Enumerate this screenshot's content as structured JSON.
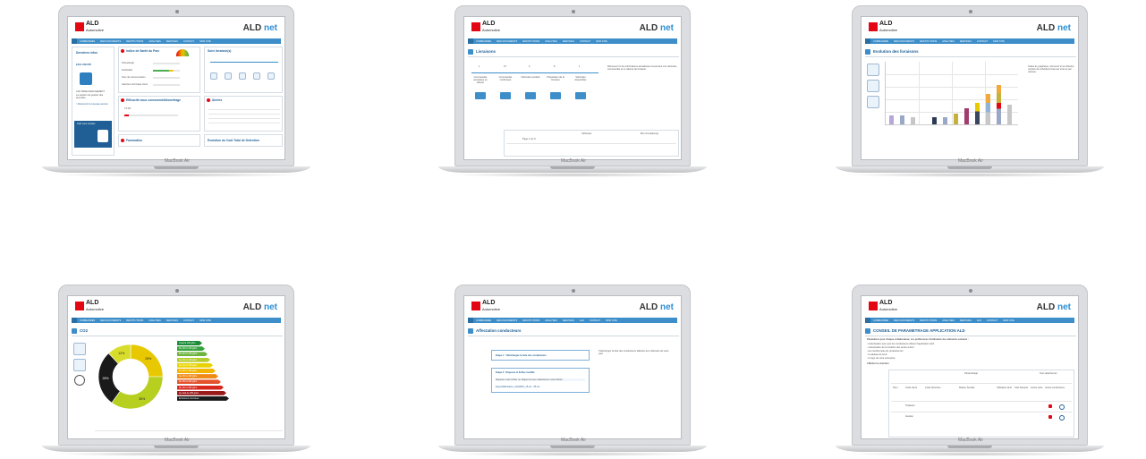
{
  "brand": {
    "logo_main": "ALD",
    "logo_sub": "Automotive",
    "product": "ALD",
    "product_suffix": "net"
  },
  "device_label": "MacBook Air",
  "nav_items_a": [
    "COMMANDES",
    "MES DOCUMENTS",
    "RESTITUTIONS",
    "ANALYSES",
    "SERVICES",
    "CONTACT",
    "MON SITE"
  ],
  "nav_items_b": [
    "COMMANDES",
    "MES DOCUMENTS",
    "RESTITUTIONS",
    "ANALYSES",
    "SERVICES",
    "ALD",
    "CONTACT",
    "MON SITE"
  ],
  "screens": {
    "s1": {
      "sidebar_title": "Dernières infos",
      "exclusive": "EXCLUSIVITÉ",
      "news_title": "ALD FREE MANAGEMENT",
      "news_text": "La solution de gestion des amendes",
      "news_link": "> Découvrir le nouveau service",
      "card_title": "ALD vous contact",
      "panel_health": "Indice de Santé du Parc",
      "health_rows": [
        "Kilométrage",
        "Sinistralité",
        "Taux de consommation",
        "Attention technique client"
      ],
      "panel_fuel": "Suivi livraison(s)",
      "panel_fuel_sub": "Efficacité sous consommé/kilométrage",
      "fuel_pct": "74.2%",
      "panel_alerts": "Alertes",
      "panel_invoices": "Facturation",
      "panel_tco": "Evolution du Coût Total de Détention"
    },
    "s2": {
      "title": "Livraisons",
      "steps_numbers": [
        "1",
        "37",
        "2",
        "8",
        "1"
      ],
      "steps": [
        "Commandes acceptées en attente",
        "Commandes confirmées",
        "Véhicules produits",
        "Préparation de la livraison",
        "Véhicules disponibles"
      ],
      "desc": "Retrouvez ici les informations actualisées concernant vos véhicules commandés et en attente de livraison.",
      "table_title": "Véhicules",
      "table_side": "Bon circulation(s)",
      "pager": "Page 1 sur 9"
    },
    "s3": {
      "title": "Evolution des livraisons",
      "desc": "Grâce au graphique, retrouvez ici en détail le nombre de véhicules livrés par mois et par marque."
    },
    "s4": {
      "title": "CO2",
      "legend": [
        "Jusqu'à 100 g/km",
        "De 101 à 120 g/km",
        "De 121 à 130 g/km",
        "De 131 à 140 g/km",
        "De 141 à 150 g/km",
        "De 151 à 160 g/km",
        "De 161 à 190 g/km",
        "De 191 à 200 g/km",
        "De 201 à 250 g/km",
        "Au delà de 250 g/km",
        "Emissions inconnues"
      ],
      "donut": [
        {
          "label": "25%",
          "value": 25,
          "color": "#e8c800"
        },
        {
          "label": "35%",
          "value": 35,
          "color": "#b7cf1f"
        },
        {
          "label": "28%",
          "value": 28,
          "color": "#1a1a1a"
        },
        {
          "label": "12%",
          "value": 12,
          "color": "#d8dc2a"
        }
      ]
    },
    "s5": {
      "title": "Affectation conducteurs",
      "step1": "Etape 1 : Téléchargez la liste des conducteurs",
      "step2": "Etape 2 : Déposez le fichier modifié",
      "drop_hint": "Déposez votre fichier ou cliquez ici pour sélectionner votre fichier",
      "file_name": "ExportAffectation_ALD2015_15.xls  -  55 Ko",
      "desc": "Téléchargez la liste des conducteurs affectés aux véhicules de votre parc"
    },
    "s6": {
      "title": "CONSEIL DE PARAMETRAGE APPLICATION ALD",
      "intro": "Paramétrez pour chaque collaborateur, vos préférences d'utilisation des éléments suivants :",
      "bullets": [
        "- l'autorisation pour que les conducteurs utilisent l'application ALD",
        "- l'autorisation de la création des accès à ALD",
        "- les coordonnées du professionnel",
        "- le tableau de bord",
        "- le logo de votre entreprise"
      ],
      "checkbox_label": "Afficher la structure",
      "table_title": "Paramétrage",
      "table_side": "Tout sélectionner",
      "cols": [
        "Nom",
        "Code client",
        "Code Structure",
        "Raison Sociale",
        "Utilisation ALD",
        "ALD Fleetnet",
        "Accès carte",
        "Accès conducteurs"
      ],
      "rows": [
        "Thalasso",
        "Gestion"
      ]
    }
  }
}
